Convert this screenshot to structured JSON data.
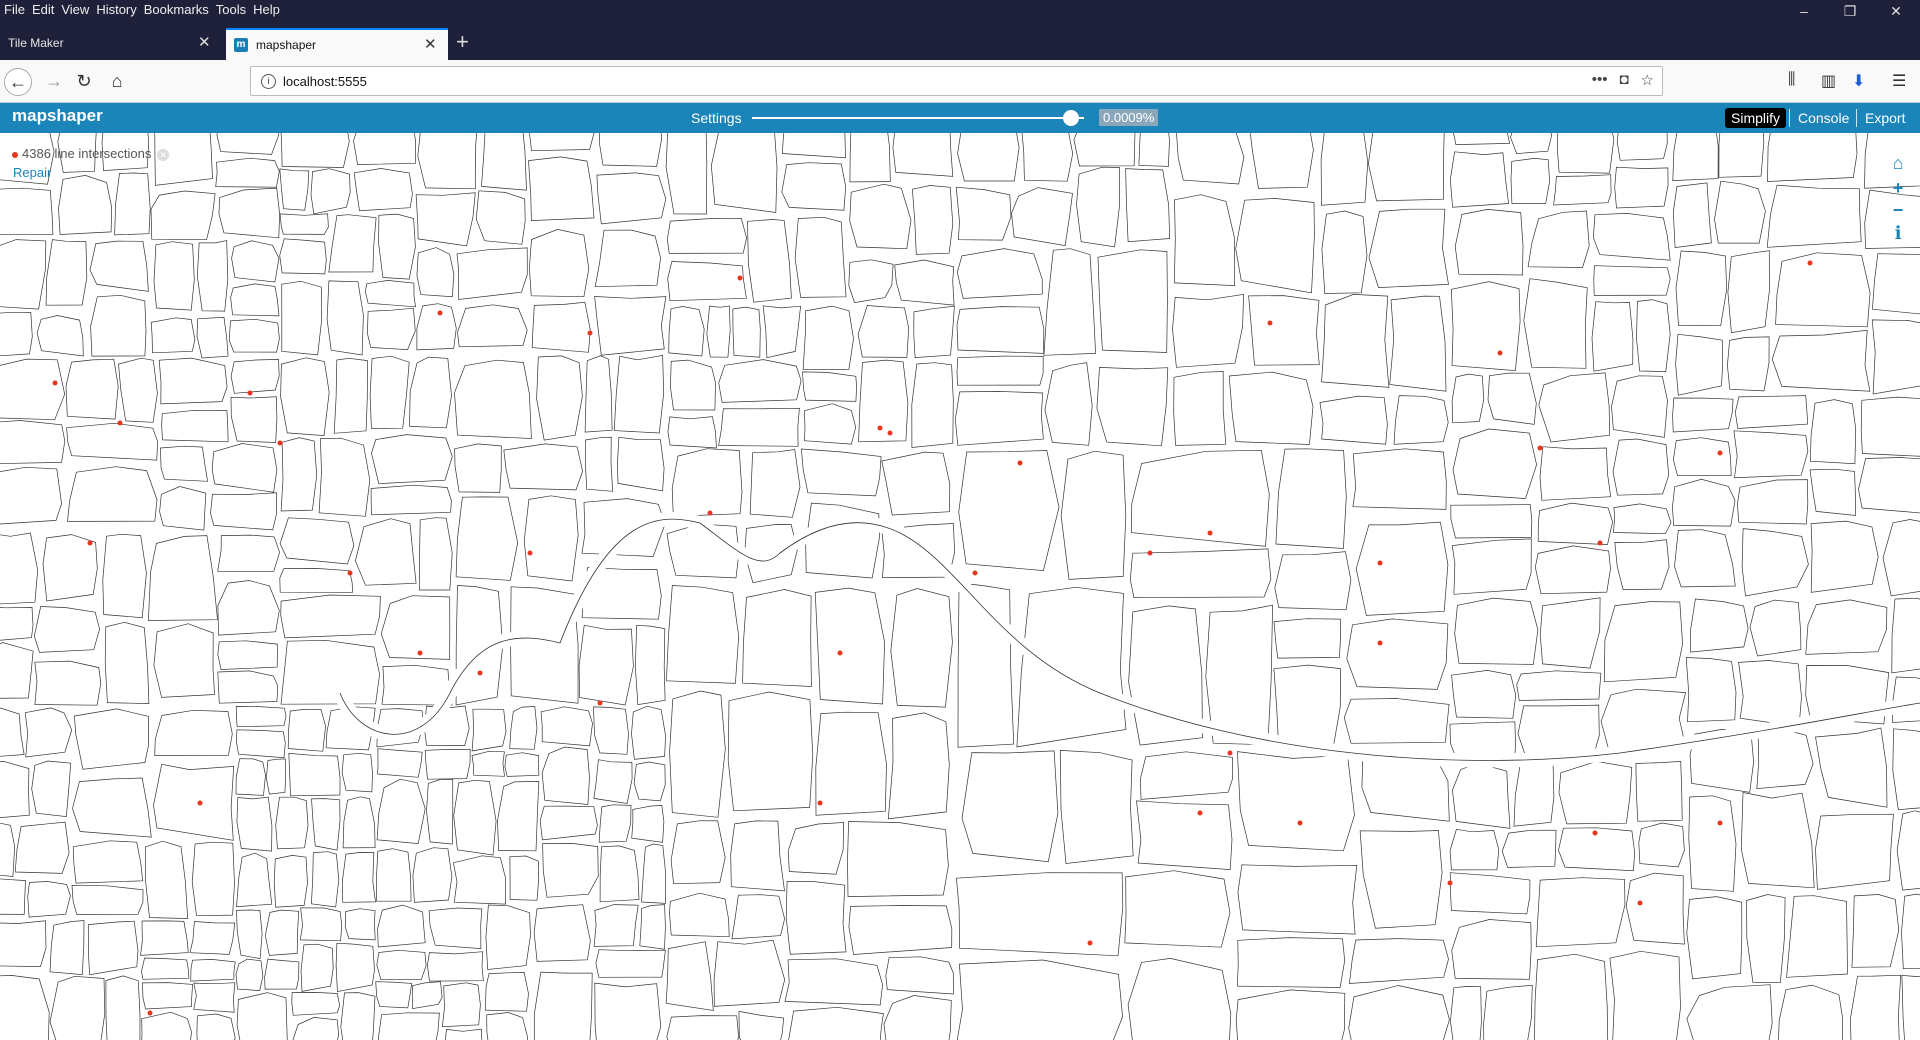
{
  "menu": [
    "File",
    "Edit",
    "View",
    "History",
    "Bookmarks",
    "Tools",
    "Help"
  ],
  "window_controls": {
    "minimize": "–",
    "restore": "❐",
    "close": "✕"
  },
  "tabs": [
    {
      "title": "Tile Maker",
      "active": false
    },
    {
      "title": "mapshaper",
      "active": true
    }
  ],
  "new_tab": "+",
  "nav": {
    "url": "localhost:5555"
  },
  "mapshaper": {
    "logo": "mapshaper",
    "settings": "Settings",
    "simplify_pct": "0.0009%",
    "simplify_level": 0.96,
    "buttons": {
      "simplify": "Simplify",
      "console": "Console",
      "export": "Export"
    }
  },
  "map": {
    "intersections_label": "4386 line intersections",
    "repair": "Repair",
    "controls": [
      "home-icon",
      "zoom-in-icon",
      "zoom-out-icon",
      "info-icon"
    ]
  },
  "colors": {
    "header": "#1b85ba",
    "chrome": "#1f213a",
    "intersection_point": "#e8351d",
    "map_line": "#333333"
  }
}
